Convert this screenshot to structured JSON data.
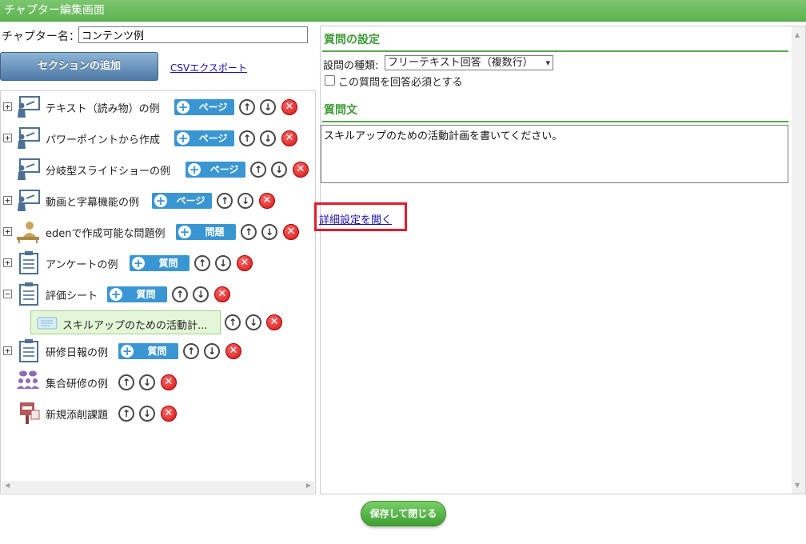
{
  "window": {
    "title": "チャプター編集画面"
  },
  "chapter": {
    "name_label": "チャプター名：",
    "name_value": "コンテンツ例"
  },
  "toolbar": {
    "add_section_label": "セクションの追加",
    "csv_export_label": "CSVエクスポート"
  },
  "tree": {
    "items": [
      {
        "label": "テキスト（読み物）の例",
        "icon": "presentation-icon",
        "expander": "+",
        "add_label": "ページ"
      },
      {
        "label": "パワーポイントから作成",
        "icon": "presentation-icon",
        "expander": "+",
        "add_label": "ページ"
      },
      {
        "label": "分岐型スライドショーの例",
        "icon": "presentation-icon",
        "expander": "",
        "add_label": "ページ"
      },
      {
        "label": "動画と字幕機能の例",
        "icon": "presentation-icon",
        "expander": "+",
        "add_label": "ページ"
      },
      {
        "label": "edenで作成可能な問題例",
        "icon": "test-taker-icon",
        "expander": "+",
        "add_label": "問題"
      },
      {
        "label": "アンケートの例",
        "icon": "clipboard-icon",
        "expander": "+",
        "add_label": "質問"
      },
      {
        "label": "評価シート",
        "icon": "clipboard-icon",
        "expander": "−",
        "add_label": "質問"
      },
      {
        "label": "スキルアップのための活動計...",
        "icon": "text-card-icon",
        "expander": "",
        "add_label": ""
      },
      {
        "label": "研修日報の例",
        "icon": "clipboard-icon",
        "expander": "+",
        "add_label": "質問"
      },
      {
        "label": "集合研修の例",
        "icon": "group-icon",
        "expander": "",
        "add_label": ""
      },
      {
        "label": "新規添削課題",
        "icon": "postbox-icon",
        "expander": "",
        "add_label": ""
      }
    ]
  },
  "question": {
    "section_title": "質問の設定",
    "type_label": "設問の種類:",
    "type_value": "フリーテキスト回答（複数行）",
    "required_label": "この質問を回答必須とする",
    "required_checked": false,
    "text_title": "質問文",
    "text_value": "スキルアップのための活動計画を書いてください。",
    "detail_link": "詳細設定を開く"
  },
  "footer": {
    "save_close_label": "保存して閉じる"
  },
  "colors": {
    "header_green": "#5db350",
    "accent_blue": "#3a96d3",
    "delete_red": "#d01414",
    "highlight_red": "#e41c2b"
  }
}
